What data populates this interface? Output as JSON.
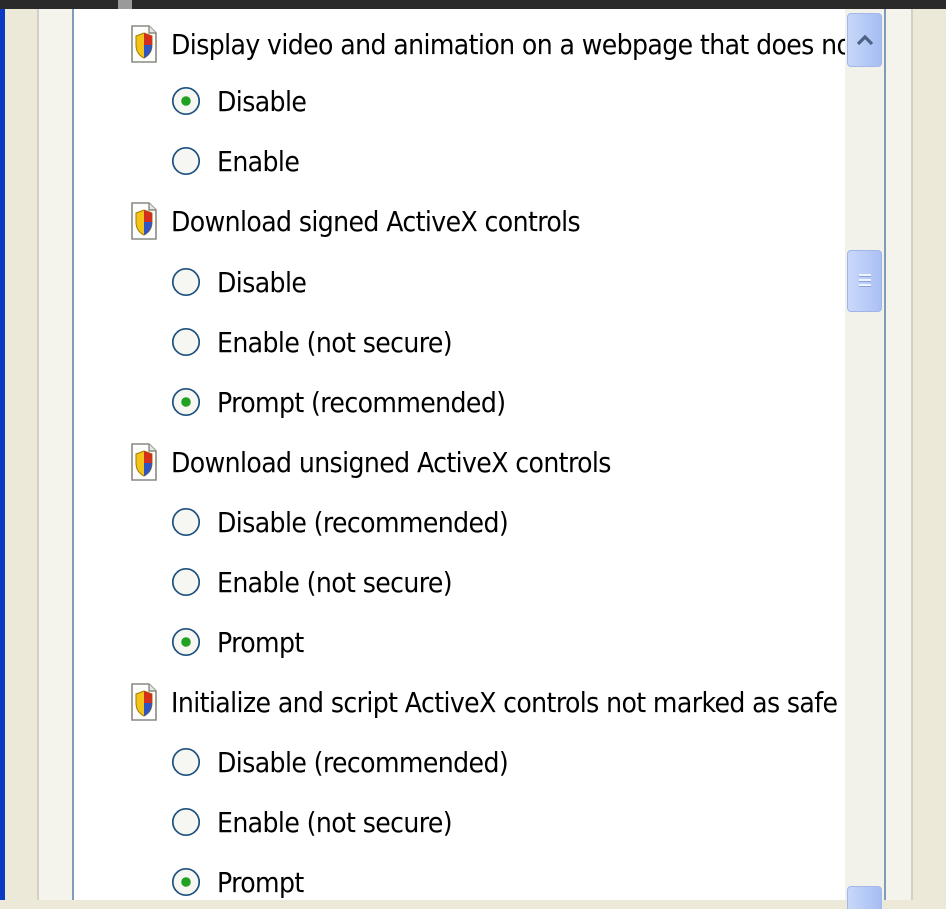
{
  "settings": [
    {
      "title": "Display video and animation on a webpage that does not use",
      "options": [
        {
          "label": "Disable",
          "selected": true
        },
        {
          "label": "Enable",
          "selected": false
        }
      ]
    },
    {
      "title": "Download signed ActiveX controls",
      "options": [
        {
          "label": "Disable",
          "selected": false
        },
        {
          "label": "Enable (not secure)",
          "selected": false
        },
        {
          "label": "Prompt (recommended)",
          "selected": true
        }
      ]
    },
    {
      "title": "Download unsigned ActiveX controls",
      "options": [
        {
          "label": "Disable (recommended)",
          "selected": false
        },
        {
          "label": "Enable (not secure)",
          "selected": false
        },
        {
          "label": "Prompt",
          "selected": true
        }
      ]
    },
    {
      "title": "Initialize and script ActiveX controls not marked as safe for sc",
      "options": [
        {
          "label": "Disable (recommended)",
          "selected": false
        },
        {
          "label": "Enable (not secure)",
          "selected": false
        },
        {
          "label": "Prompt",
          "selected": true
        }
      ]
    }
  ],
  "icons": {
    "setting": "setting-shield-icon",
    "scroll_up": "chevron-up-icon",
    "thumb_grip": "grip-icon"
  },
  "colors": {
    "radio_dot": "#21a121",
    "scroll_accent": "#4d6185"
  }
}
